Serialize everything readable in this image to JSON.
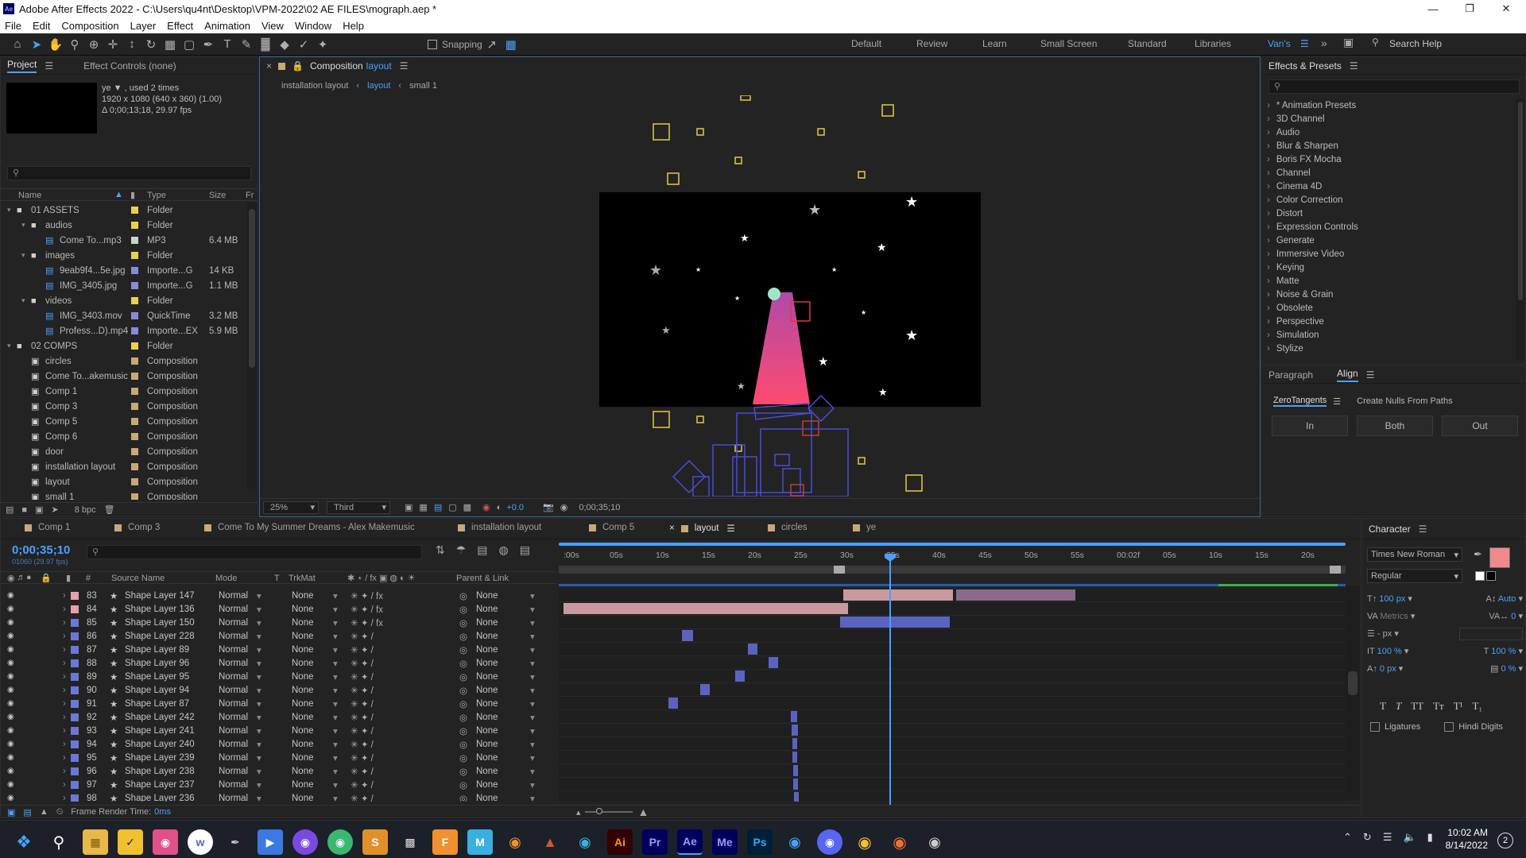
{
  "window": {
    "title": "Adobe After Effects 2022 - C:\\Users\\qu4nt\\Desktop\\VPM-2022\\02 AE FILES\\mograph.aep *",
    "logo_text": "Ae"
  },
  "menu": [
    "File",
    "Edit",
    "Composition",
    "Layer",
    "Effect",
    "Animation",
    "View",
    "Window",
    "Help"
  ],
  "toolbar": {
    "snapping_label": "Snapping",
    "search_placeholder": "Search Help"
  },
  "workspaces": [
    "Default",
    "Review",
    "Learn",
    "Small Screen",
    "Standard",
    "Libraries",
    "Van's"
  ],
  "project": {
    "tab": "Project",
    "effect_controls": "Effect Controls (none)",
    "info_name": "ye ▼ , used 2 times",
    "info_size": "1920 x 1080  (640 x 360) (1.00)",
    "info_duration": "Δ 0;00;13;18, 29.97 fps",
    "col_name": "Name",
    "col_type": "Type",
    "col_size": "Size",
    "col_fr": "Fr",
    "bpc": "8 bpc",
    "items": [
      {
        "indent": 0,
        "kind": "folder",
        "name": "01 ASSETS",
        "color": "#e8d24a",
        "type": "Folder",
        "size": ""
      },
      {
        "indent": 1,
        "kind": "folder",
        "name": "audios",
        "color": "#e8d24a",
        "type": "Folder",
        "size": ""
      },
      {
        "indent": 2,
        "kind": "file",
        "name": "Come To...mp3",
        "color": "#cfcfcf",
        "type": "MP3",
        "size": "6.4 MB"
      },
      {
        "indent": 1,
        "kind": "folder",
        "name": "images",
        "color": "#e8d24a",
        "type": "Folder",
        "size": ""
      },
      {
        "indent": 2,
        "kind": "file",
        "name": "9eab9f4...5e.jpg",
        "color": "#8a8ad8",
        "type": "Importe...G",
        "size": "14 KB"
      },
      {
        "indent": 2,
        "kind": "file",
        "name": "IMG_3405.jpg",
        "color": "#8a8ad8",
        "type": "Importe...G",
        "size": "1.1 MB"
      },
      {
        "indent": 1,
        "kind": "folder",
        "name": "videos",
        "color": "#e8d24a",
        "type": "Folder",
        "size": ""
      },
      {
        "indent": 2,
        "kind": "file",
        "name": "IMG_3403.mov",
        "color": "#8a8ad8",
        "type": "QuickTime",
        "size": "3.2 MB"
      },
      {
        "indent": 2,
        "kind": "file",
        "name": "Profess...D).mp4",
        "color": "#8a8ad8",
        "type": "Importe...EX",
        "size": "5.9 MB"
      },
      {
        "indent": 0,
        "kind": "folder",
        "name": "02 COMPS",
        "color": "#e8d24a",
        "type": "Folder",
        "size": ""
      },
      {
        "indent": 1,
        "kind": "comp",
        "name": "circles",
        "color": "#c8a878",
        "type": "Composition",
        "size": ""
      },
      {
        "indent": 1,
        "kind": "comp",
        "name": "Come To...akemusic",
        "color": "#c8a878",
        "type": "Composition",
        "size": ""
      },
      {
        "indent": 1,
        "kind": "comp",
        "name": "Comp 1",
        "color": "#c8a878",
        "type": "Composition",
        "size": ""
      },
      {
        "indent": 1,
        "kind": "comp",
        "name": "Comp 3",
        "color": "#c8a878",
        "type": "Composition",
        "size": ""
      },
      {
        "indent": 1,
        "kind": "comp",
        "name": "Comp 5",
        "color": "#c8a878",
        "type": "Composition",
        "size": ""
      },
      {
        "indent": 1,
        "kind": "comp",
        "name": "Comp 6",
        "color": "#c8a878",
        "type": "Composition",
        "size": ""
      },
      {
        "indent": 1,
        "kind": "comp",
        "name": "door",
        "color": "#c8a878",
        "type": "Composition",
        "size": ""
      },
      {
        "indent": 1,
        "kind": "comp",
        "name": "installation layout",
        "color": "#c8a878",
        "type": "Composition",
        "size": ""
      },
      {
        "indent": 1,
        "kind": "comp",
        "name": "layout",
        "color": "#c8a878",
        "type": "Composition",
        "size": ""
      },
      {
        "indent": 1,
        "kind": "comp",
        "name": "small 1",
        "color": "#c8a878",
        "type": "Composition",
        "size": ""
      }
    ]
  },
  "composition": {
    "tab_prefix": "Composition",
    "tab_name": "layout",
    "breadcrumbs": [
      "installation layout",
      "layout",
      "small 1"
    ],
    "zoom": "25%",
    "view": "Third",
    "exposure": "+0.0",
    "timecode": "0;00;35;10"
  },
  "effects": {
    "title": "Effects & Presets",
    "items": [
      "* Animation Presets",
      "3D Channel",
      "Audio",
      "Blur & Sharpen",
      "Boris FX Mocha",
      "Channel",
      "Cinema 4D",
      "Color Correction",
      "Distort",
      "Expression Controls",
      "Generate",
      "Immersive Video",
      "Keying",
      "Matte",
      "Noise & Grain",
      "Obsolete",
      "Perspective",
      "Simulation",
      "Stylize"
    ]
  },
  "align_panel": {
    "tabs": [
      "Paragraph",
      "Align"
    ],
    "zero_tab": "ZeroTangents",
    "nulls_tab": "Create Nulls From Paths",
    "buttons": [
      "In",
      "Both",
      "Out"
    ]
  },
  "timeline": {
    "tabs": [
      {
        "name": "Comp 1",
        "color": "#c8a878"
      },
      {
        "name": "Comp 3",
        "color": "#c8a878"
      },
      {
        "name": "Come To My Summer Dreams - Alex Makemusic",
        "color": "#c8a878"
      },
      {
        "name": "installation layout",
        "color": "#c8a878"
      },
      {
        "name": "Comp 5",
        "color": "#c8a878"
      },
      {
        "name": "layout",
        "color": "#c8a878"
      },
      {
        "name": "circles",
        "color": "#c8a878"
      },
      {
        "name": "ye",
        "color": "#c8a878"
      }
    ],
    "timecode": "0;00;35;10",
    "frame_info": "01060 (29.97 fps)",
    "columns": {
      "num": "#",
      "source": "Source Name",
      "mode": "Mode",
      "t": "T",
      "trkmat": "TrkMat",
      "parent": "Parent & Link"
    },
    "ruler": [
      ":00s",
      "05s",
      "10s",
      "15s",
      "20s",
      "25s",
      "30s",
      "35s",
      "40s",
      "45s",
      "50s",
      "55s",
      "00:02f",
      "05s",
      "10s",
      "15s",
      "20s"
    ],
    "frame_render": "Frame Render Time:",
    "frame_render_value": "0ms",
    "layers": [
      {
        "n": "83",
        "name": "Shape Layer 147",
        "color": "#e6a0a8",
        "mode": "Normal",
        "trk": "None",
        "parent": "None",
        "fx": true
      },
      {
        "n": "84",
        "name": "Shape Layer 136",
        "color": "#e6a0a8",
        "mode": "Normal",
        "trk": "None",
        "parent": "None",
        "fx": true
      },
      {
        "n": "85",
        "name": "Shape Layer 150",
        "color": "#6a78d8",
        "mode": "Normal",
        "trk": "None",
        "parent": "None",
        "fx": true
      },
      {
        "n": "86",
        "name": "Shape Layer 228",
        "color": "#6a78d8",
        "mode": "Normal",
        "trk": "None",
        "parent": "None",
        "fx": false
      },
      {
        "n": "87",
        "name": "Shape Layer 89",
        "color": "#6a78d8",
        "mode": "Normal",
        "trk": "None",
        "parent": "None",
        "fx": false
      },
      {
        "n": "88",
        "name": "Shape Layer 96",
        "color": "#6a78d8",
        "mode": "Normal",
        "trk": "None",
        "parent": "None",
        "fx": false
      },
      {
        "n": "89",
        "name": "Shape Layer 95",
        "color": "#6a78d8",
        "mode": "Normal",
        "trk": "None",
        "parent": "None",
        "fx": false
      },
      {
        "n": "90",
        "name": "Shape Layer 94",
        "color": "#6a78d8",
        "mode": "Normal",
        "trk": "None",
        "parent": "None",
        "fx": false
      },
      {
        "n": "91",
        "name": "Shape Layer 87",
        "color": "#6a78d8",
        "mode": "Normal",
        "trk": "None",
        "parent": "None",
        "fx": false
      },
      {
        "n": "92",
        "name": "Shape Layer 242",
        "color": "#6a78d8",
        "mode": "Normal",
        "trk": "None",
        "parent": "None",
        "fx": false
      },
      {
        "n": "93",
        "name": "Shape Layer 241",
        "color": "#6a78d8",
        "mode": "Normal",
        "trk": "None",
        "parent": "None",
        "fx": false
      },
      {
        "n": "94",
        "name": "Shape Layer 240",
        "color": "#6a78d8",
        "mode": "Normal",
        "trk": "None",
        "parent": "None",
        "fx": false
      },
      {
        "n": "95",
        "name": "Shape Layer 239",
        "color": "#6a78d8",
        "mode": "Normal",
        "trk": "None",
        "parent": "None",
        "fx": false
      },
      {
        "n": "96",
        "name": "Shape Layer 238",
        "color": "#6a78d8",
        "mode": "Normal",
        "trk": "None",
        "parent": "None",
        "fx": false
      },
      {
        "n": "97",
        "name": "Shape Layer 237",
        "color": "#6a78d8",
        "mode": "Normal",
        "trk": "None",
        "parent": "None",
        "fx": false
      },
      {
        "n": "98",
        "name": "Shape Layer 236",
        "color": "#6a78d8",
        "mode": "Normal",
        "trk": "None",
        "parent": "None",
        "fx": false
      }
    ]
  },
  "character": {
    "title": "Character",
    "font": "Times New Roman",
    "style": "Regular",
    "size": "100 px",
    "leading": "Auto",
    "kerning": "Metrics",
    "tracking": "0",
    "stroke": "- px",
    "vscale": "100 %",
    "hscale": "100 %",
    "baseline": "0 px",
    "tsume": "0 %",
    "ligatures": "Ligatures",
    "hindi": "Hindi Digits",
    "fill_color": "#f08a8a"
  },
  "taskbar": {
    "time": "10:02 AM",
    "date": "8/14/2022",
    "apps": [
      "Ai",
      "Pr",
      "Ae",
      "Me",
      "Ps"
    ]
  }
}
